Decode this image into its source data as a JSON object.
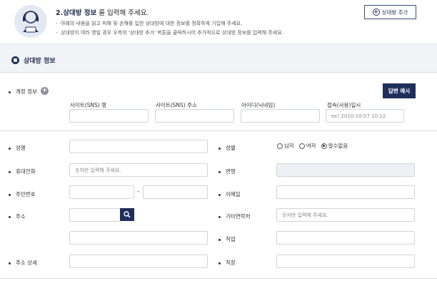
{
  "header": {
    "title_bold": "2.상대방 정보",
    "title_rest": " 를 입력해 주세요.",
    "note1": "아래의 내용을 읽고 피해 및 손해를 입힌 상대방에 대한 정보를 정확하게 기입해 주세요.",
    "note2": "상대방이 여러 명일 경우 우측의 '상대방 추가' 버튼을 클릭하시어 추가적으로 상대방 정보를 입력해 주세요.",
    "add_button": "상대방 추가"
  },
  "section": {
    "title": "상대방 정보"
  },
  "account": {
    "label": "계정 정보",
    "example_button": "답변 예시",
    "columns": [
      "사이트(SNS) 명",
      "사이트(SNS) 주소",
      "아이디(닉네임)",
      "접속(사용)일시"
    ],
    "datetime_placeholder": "ex) 2010-10-07 10:12"
  },
  "form": {
    "name": "성명",
    "gender": "성별",
    "gender_options": [
      "남자",
      "여자",
      "알수없음"
    ],
    "gender_selected": "알수없음",
    "mobile": "휴대전화",
    "mobile_placeholder": "숫자만 입력해 주세요.",
    "age": "연령",
    "rrn": "주민번호",
    "rrn_separator": "-",
    "email": "이메일",
    "address": "주소",
    "other_contact": "기타연락처",
    "other_contact_placeholder": "숫자만 입력해 주세요.",
    "job": "직업",
    "address_detail": "주소 상세",
    "workplace": "직장"
  },
  "colors": {
    "navy": "#1e2f5c",
    "section_bg": "#f2f3f6",
    "border": "#cfd3da"
  },
  "icons": {
    "header": "person-headset-icon",
    "search": "search-icon",
    "add": "plus-circle-icon",
    "info": "plus-info-icon"
  }
}
